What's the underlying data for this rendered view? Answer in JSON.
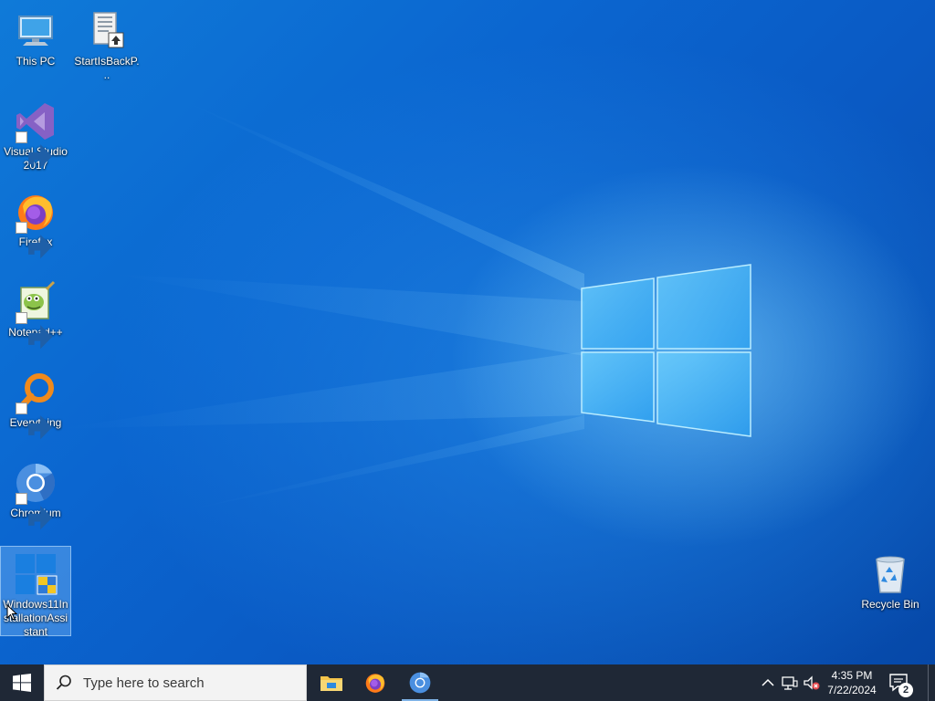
{
  "desktop": {
    "icons": [
      {
        "label": "This PC",
        "icon": "this-pc-icon"
      },
      {
        "label": "StartIsBackP...",
        "icon": "installer-file-icon"
      },
      {
        "label": "Visual Studio 2017",
        "icon": "visual-studio-icon"
      },
      {
        "label": "Firefox",
        "icon": "firefox-icon"
      },
      {
        "label": "Notepad++",
        "icon": "notepad-plus-plus-icon"
      },
      {
        "label": "Everything",
        "icon": "everything-search-icon"
      },
      {
        "label": "Chromium",
        "icon": "chromium-icon"
      },
      {
        "label": "Windows11InstallationAssistant",
        "icon": "windows11-assistant-icon",
        "selected": true
      },
      {
        "label": "Recycle Bin",
        "icon": "recycle-bin-icon"
      }
    ]
  },
  "taskbar": {
    "search_placeholder": "Type here to search",
    "pinned": [
      {
        "name": "File Explorer",
        "icon": "file-explorer-icon"
      },
      {
        "name": "Firefox",
        "icon": "firefox-icon"
      },
      {
        "name": "Chromium",
        "icon": "chromium-icon",
        "running": true
      }
    ],
    "tray": {
      "time": "4:35 PM",
      "date": "7/22/2024",
      "notification_count": "2",
      "icons": [
        "chevron-up-icon",
        "network-icon",
        "volume-muted-icon",
        "notification-center-icon"
      ]
    }
  },
  "colors": {
    "taskbar": "#1f2836",
    "desktop_blue": "#0b66d0",
    "accent": "#7fb3e6"
  }
}
